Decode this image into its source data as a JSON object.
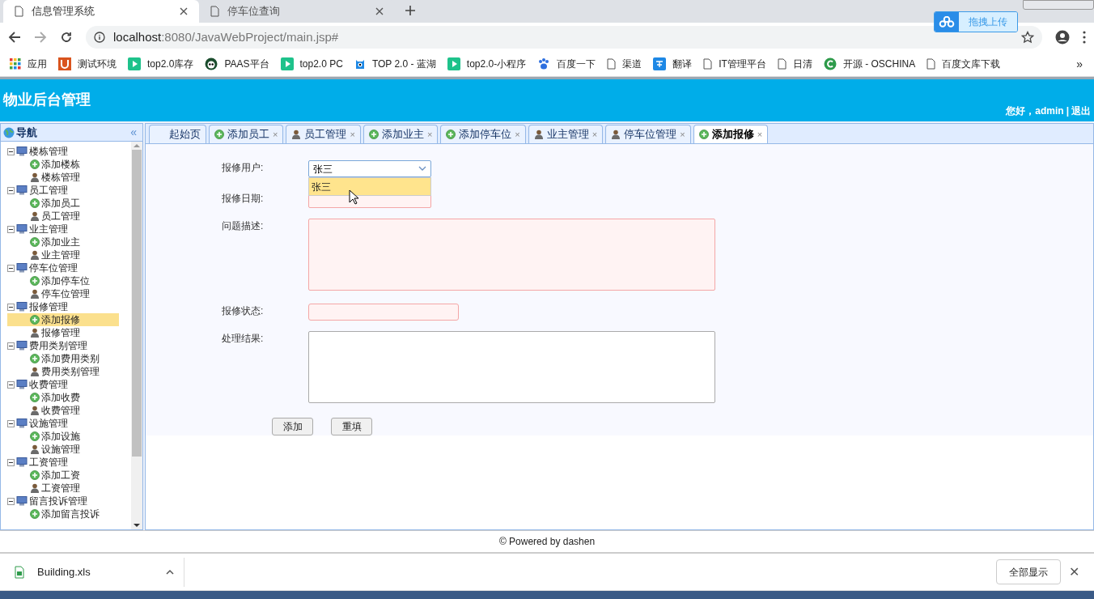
{
  "browser": {
    "tabs": [
      {
        "title": "信息管理系统",
        "selected": true
      },
      {
        "title": "停车位查询",
        "selected": false
      }
    ],
    "url_host": "localhost",
    "url_path": ":8080/JavaWebProject/main.jsp#",
    "upload_badge": "拖拽上传",
    "bookmarks": [
      {
        "label": "应用",
        "kind": "apps"
      },
      {
        "label": "测试环境",
        "kind": "u"
      },
      {
        "label": "top2.0库存",
        "kind": "play"
      },
      {
        "label": "PAAS平台",
        "kind": "panda"
      },
      {
        "label": "top2.0 PC",
        "kind": "play"
      },
      {
        "label": "TOP 2.0 - 蓝湖",
        "kind": "lanhu"
      },
      {
        "label": "top2.0-小程序",
        "kind": "play"
      },
      {
        "label": "百度一下",
        "kind": "paw"
      },
      {
        "label": "渠道",
        "kind": "page"
      },
      {
        "label": "翻译",
        "kind": "translate"
      },
      {
        "label": "IT管理平台",
        "kind": "page"
      },
      {
        "label": "日清",
        "kind": "page"
      },
      {
        "label": "开源 - OSCHINA",
        "kind": "c"
      },
      {
        "label": "百度文库下载",
        "kind": "page"
      }
    ],
    "more": "»"
  },
  "header": {
    "title": "物业后台管理",
    "greeting": "您好，admin",
    "separator": "|",
    "logout": "退出"
  },
  "nav": {
    "title": "导航",
    "collapse": "«",
    "tree": [
      {
        "label": "楼栋管理",
        "children": [
          {
            "label": "添加楼栋",
            "kind": "add",
            "selected": false
          },
          {
            "label": "楼栋管理",
            "kind": "manage",
            "selected": false
          }
        ]
      },
      {
        "label": "员工管理",
        "children": [
          {
            "label": "添加员工",
            "kind": "add",
            "selected": false
          },
          {
            "label": "员工管理",
            "kind": "manage",
            "selected": false
          }
        ]
      },
      {
        "label": "业主管理",
        "children": [
          {
            "label": "添加业主",
            "kind": "add",
            "selected": false
          },
          {
            "label": "业主管理",
            "kind": "manage",
            "selected": false
          }
        ]
      },
      {
        "label": "停车位管理",
        "children": [
          {
            "label": "添加停车位",
            "kind": "add",
            "selected": false
          },
          {
            "label": "停车位管理",
            "kind": "manage",
            "selected": false
          }
        ]
      },
      {
        "label": "报修管理",
        "children": [
          {
            "label": "添加报修",
            "kind": "add",
            "selected": true
          },
          {
            "label": "报修管理",
            "kind": "manage",
            "selected": false
          }
        ]
      },
      {
        "label": "费用类别管理",
        "children": [
          {
            "label": "添加费用类别",
            "kind": "add",
            "selected": false
          },
          {
            "label": "费用类别管理",
            "kind": "manage",
            "selected": false
          }
        ]
      },
      {
        "label": "收费管理",
        "children": [
          {
            "label": "添加收费",
            "kind": "add",
            "selected": false
          },
          {
            "label": "收费管理",
            "kind": "manage",
            "selected": false
          }
        ]
      },
      {
        "label": "设施管理",
        "children": [
          {
            "label": "添加设施",
            "kind": "add",
            "selected": false
          },
          {
            "label": "设施管理",
            "kind": "manage",
            "selected": false
          }
        ]
      },
      {
        "label": "工资管理",
        "children": [
          {
            "label": "添加工资",
            "kind": "add",
            "selected": false
          },
          {
            "label": "工资管理",
            "kind": "manage",
            "selected": false
          }
        ]
      },
      {
        "label": "留言投诉管理",
        "children": [
          {
            "label": "添加留言投诉",
            "kind": "add",
            "selected": false
          }
        ]
      }
    ]
  },
  "content_tabs": [
    {
      "label": "起始页",
      "kind": "home",
      "selected": false
    },
    {
      "label": "添加员工",
      "kind": "add",
      "selected": false
    },
    {
      "label": "员工管理",
      "kind": "manage",
      "selected": false
    },
    {
      "label": "添加业主",
      "kind": "add",
      "selected": false
    },
    {
      "label": "添加停车位",
      "kind": "add",
      "selected": false
    },
    {
      "label": "业主管理",
      "kind": "manage",
      "selected": false
    },
    {
      "label": "停车位管理",
      "kind": "manage",
      "selected": false
    },
    {
      "label": "添加报修",
      "kind": "add",
      "selected": true
    }
  ],
  "tab_close": "×",
  "form": {
    "fields": [
      {
        "label": "报修用户:",
        "kind": "select",
        "value": "张三",
        "options": [
          {
            "label": "张三",
            "selected": true
          }
        ]
      },
      {
        "label": "报修日期:",
        "kind": "date"
      },
      {
        "label": "问题描述:",
        "kind": "textarea",
        "invalid": true
      },
      {
        "label": "报修状态:",
        "kind": "text",
        "invalid": true
      },
      {
        "label": "处理结果:",
        "kind": "textarea",
        "invalid": false
      }
    ],
    "buttons": [
      "添加",
      "重填"
    ]
  },
  "footer": "© Powered by dashen",
  "downloads": {
    "file": "Building.xls",
    "show_all": "全部显示",
    "close": "✕"
  }
}
